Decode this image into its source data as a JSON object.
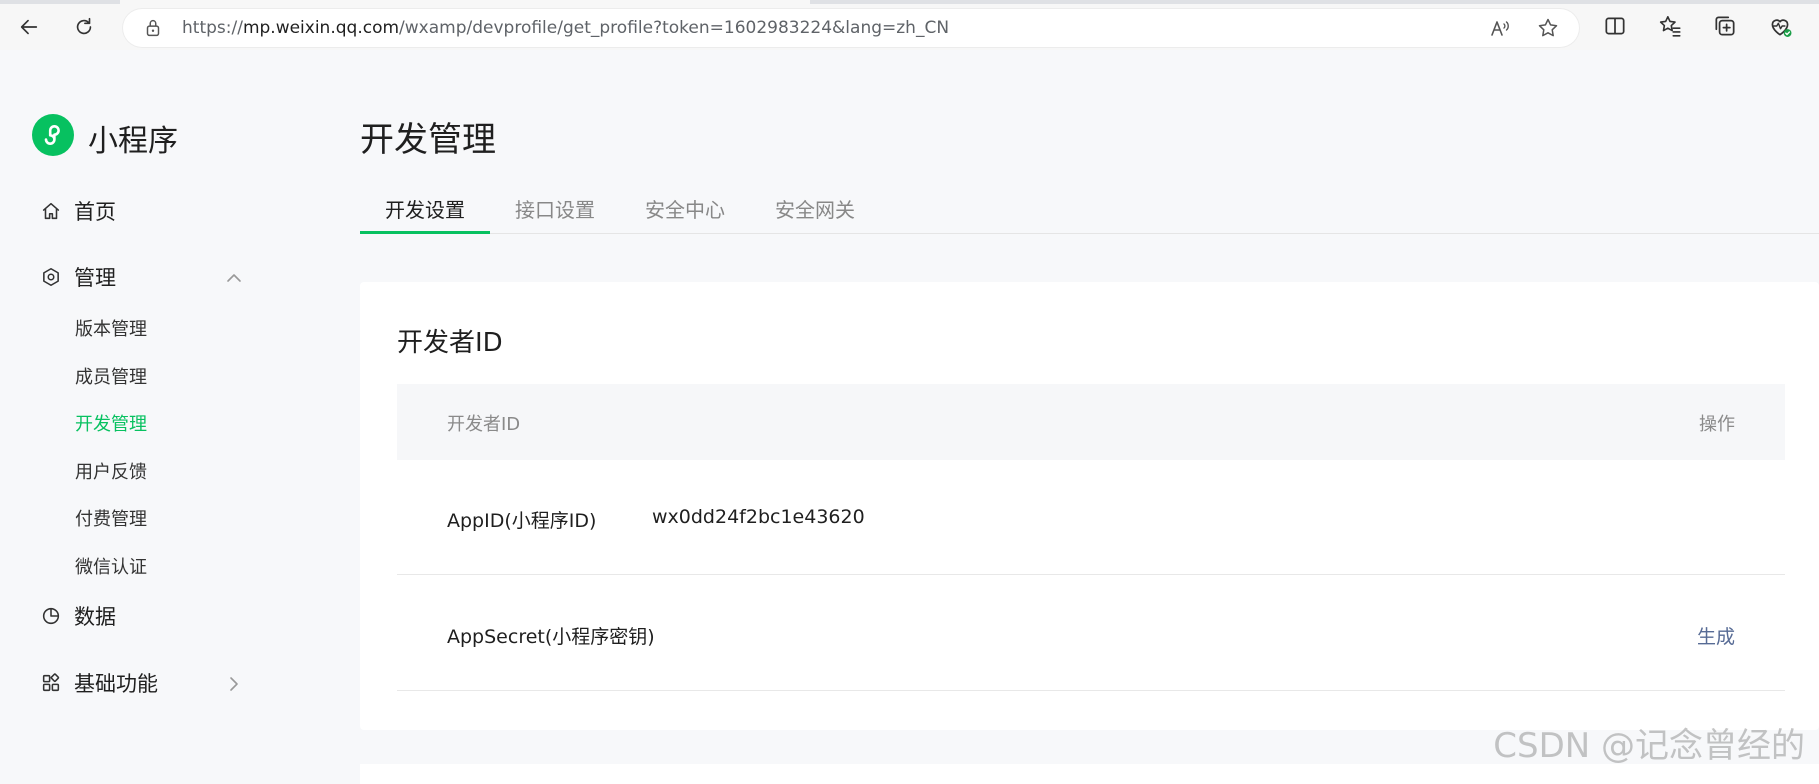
{
  "browser": {
    "url_scheme": "https://",
    "url_host": "mp.weixin.qq.com",
    "url_path": "/wxamp/devprofile/get_profile?token=1602983224&lang=zh_CN"
  },
  "sidebar": {
    "brand": "小程序",
    "items": [
      {
        "label": "首页"
      },
      {
        "label": "管理"
      },
      {
        "label": "数据"
      },
      {
        "label": "基础功能"
      }
    ],
    "submenu": [
      {
        "label": "版本管理"
      },
      {
        "label": "成员管理"
      },
      {
        "label": "开发管理"
      },
      {
        "label": "用户反馈"
      },
      {
        "label": "付费管理"
      },
      {
        "label": "微信认证"
      }
    ],
    "active_submenu": "开发管理"
  },
  "main": {
    "title": "开发管理",
    "tabs": [
      {
        "label": "开发设置"
      },
      {
        "label": "接口设置"
      },
      {
        "label": "安全中心"
      },
      {
        "label": "安全网关"
      }
    ],
    "active_tab": "开发设置",
    "card": {
      "title": "开发者ID",
      "columns": {
        "id": "开发者ID",
        "action": "操作"
      },
      "rows": [
        {
          "name": "AppID(小程序ID)",
          "value": "wx0dd24f2bc1e43620",
          "action": ""
        },
        {
          "name": "AppSecret(小程序密钥)",
          "value": "",
          "action": "生成"
        }
      ]
    }
  },
  "watermark": "CSDN @记念曾经的",
  "colors": {
    "accent": "#07c160",
    "link": "#576b95"
  }
}
